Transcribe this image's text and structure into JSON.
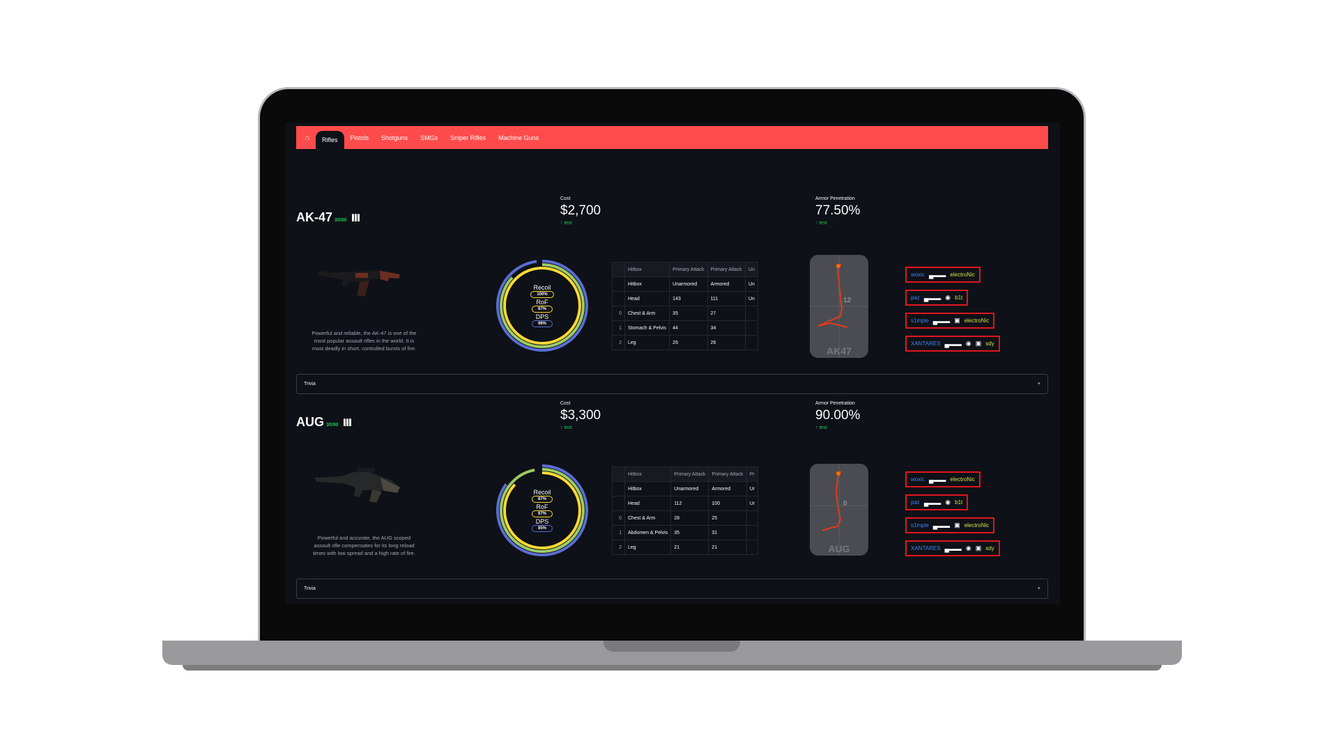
{
  "nav": {
    "home_icon": "home-icon",
    "tabs": [
      "Rifles",
      "Pistols",
      "Shotguns",
      "SMGs",
      "Sniper Rifles",
      "Machine Guns"
    ],
    "active": "Rifles"
  },
  "colors": {
    "nav": "#ff4b4b",
    "bg": "#0e1117",
    "delta": "#21c354",
    "border_red": "#e0161e"
  },
  "weapons": [
    {
      "name": "AK-47",
      "ammo": "30/90",
      "description": "Powerful and reliable, the AK-47 is one of the most popular assault rifles in the world. It is most deadly in short, controlled bursts of fire.",
      "cost": {
        "label": "Cost",
        "value": "$2,700",
        "delta": "test"
      },
      "armor": {
        "label": "Armor Penetration",
        "value": "77.50%",
        "delta": "test"
      },
      "gauge": {
        "recoil": "100%",
        "rof": "87%",
        "dps": "98%",
        "recoil_frac": 1.0,
        "rof_frac": 0.87,
        "dps_frac": 0.98
      },
      "table": {
        "headers": [
          "",
          "Hitbox",
          "Primary Attack",
          "Primary Attack",
          "Un"
        ],
        "rows": [
          [
            "",
            "Hitbox",
            "Unarmored",
            "Armored",
            "Un"
          ],
          [
            "",
            "Head",
            "143",
            "111",
            "Un"
          ],
          [
            "0",
            "Chest & Arm",
            "35",
            "27",
            ""
          ],
          [
            "1",
            "Stomach & Pelvis",
            "44",
            "34",
            ""
          ],
          [
            "2",
            "Leg",
            "26",
            "26",
            ""
          ]
        ]
      },
      "spray": {
        "name": "AK47",
        "number": "12"
      },
      "pros": [
        {
          "player": "woxic",
          "team": "electroNic"
        },
        {
          "player": "paz",
          "team": "b1t"
        },
        {
          "player": "s1mple",
          "team": "electroNic"
        },
        {
          "player": "XANTARES",
          "team": "sdy"
        }
      ],
      "trivia": "Trivia"
    },
    {
      "name": "AUG",
      "ammo": "30/90",
      "description": "Powerful and accurate, the AUG scoped assault rifle compensates for its long reload times with low spread and a high rate of fire.",
      "cost": {
        "label": "Cost",
        "value": "$3,300",
        "delta": "test"
      },
      "armor": {
        "label": "Armor Penetration",
        "value": "90.00%",
        "delta": "test"
      },
      "gauge": {
        "recoil": "87%",
        "rof": "97%",
        "dps": "85%",
        "recoil_frac": 0.87,
        "rof_frac": 0.97,
        "dps_frac": 0.85
      },
      "table": {
        "headers": [
          "",
          "Hitbox",
          "Primary Attack",
          "Primary Attack",
          "Pr"
        ],
        "rows": [
          [
            "",
            "Hitbox",
            "Unarmored",
            "Armored",
            "Ur"
          ],
          [
            "",
            "Head",
            "112",
            "100",
            "Ur"
          ],
          [
            "0",
            "Chest & Arm",
            "28",
            "25",
            ""
          ],
          [
            "1",
            "Abdomen & Pelvis",
            "35",
            "31",
            ""
          ],
          [
            "2",
            "Leg",
            "21",
            "21",
            ""
          ]
        ]
      },
      "spray": {
        "name": "AUG",
        "number": "0"
      },
      "pros": [
        {
          "player": "woxic",
          "team": "electroNic"
        },
        {
          "player": "paz",
          "team": "b1t"
        },
        {
          "player": "s1mple",
          "team": "electroNic"
        },
        {
          "player": "XANTARES",
          "team": "sdy"
        }
      ],
      "trivia": "Trivia"
    }
  ]
}
